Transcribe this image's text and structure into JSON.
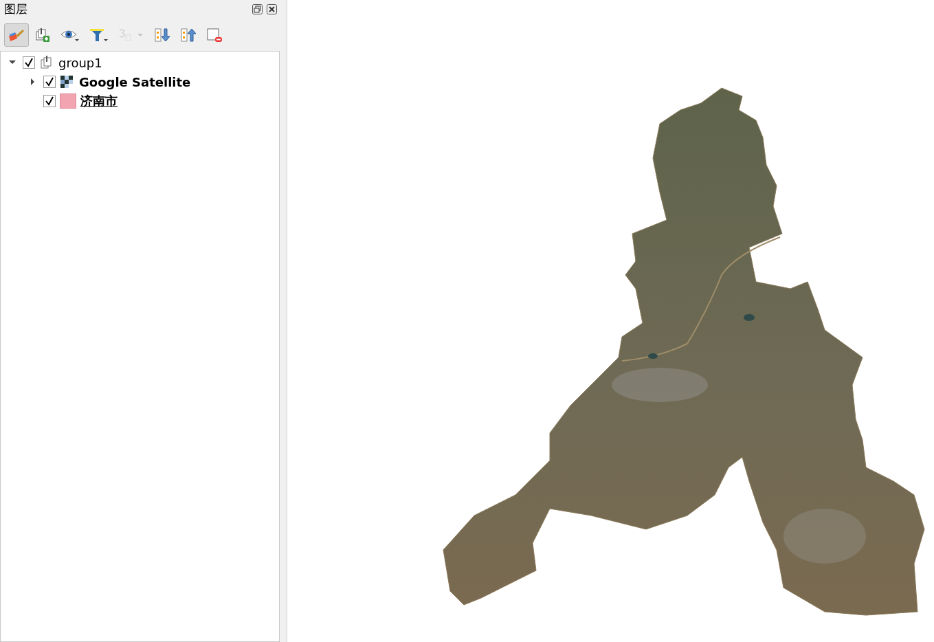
{
  "panel": {
    "title": "图层"
  },
  "toolbar": [
    {
      "kind": "style",
      "pressed": true,
      "disabled": false
    },
    {
      "kind": "add-group",
      "pressed": false,
      "disabled": false
    },
    {
      "kind": "visibility",
      "pressed": false,
      "disabled": false
    },
    {
      "kind": "filter",
      "pressed": false,
      "disabled": false
    },
    {
      "kind": "expression",
      "pressed": false,
      "disabled": true
    },
    {
      "kind": "expand",
      "pressed": false,
      "disabled": false
    },
    {
      "kind": "collapse",
      "pressed": false,
      "disabled": false
    },
    {
      "kind": "remove",
      "pressed": false,
      "disabled": false
    }
  ],
  "layers": [
    {
      "kind": "group",
      "name": "group1",
      "checked": true,
      "expanded": true,
      "bold": false,
      "underlined": false,
      "children": [
        {
          "kind": "raster",
          "name": "Google Satellite",
          "checked": true,
          "expanded": false,
          "bold": true,
          "underlined": false
        },
        {
          "kind": "vector",
          "name": "济南市",
          "checked": true,
          "color": "#f2a5b0",
          "bold": true,
          "underlined": true
        }
      ]
    }
  ]
}
